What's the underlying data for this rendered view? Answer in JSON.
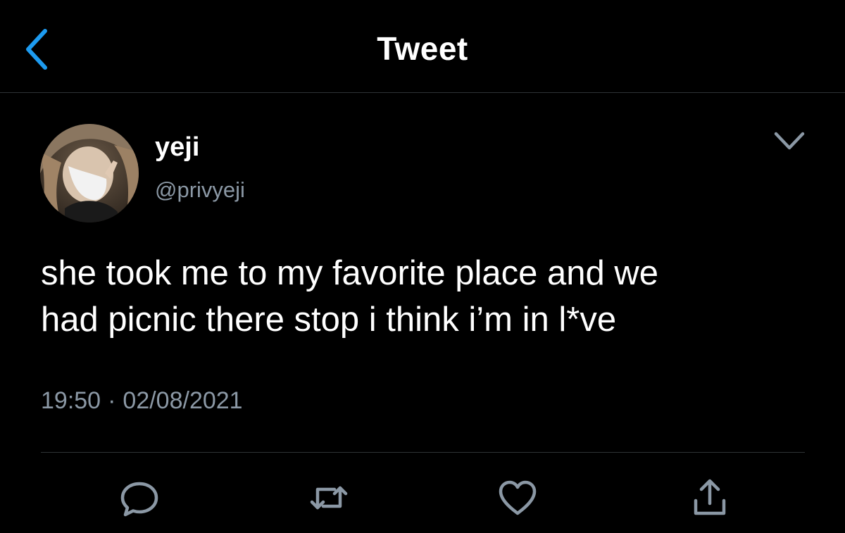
{
  "header": {
    "title": "Tweet",
    "back_icon": "chevron-left-icon"
  },
  "colors": {
    "accent": "#1d9bf0",
    "background": "#000000",
    "secondary_text": "#8b98a5",
    "divider": "#2f3336"
  },
  "author": {
    "display_name": "yeji",
    "handle": "@privyeji"
  },
  "tweet": {
    "lines": [
      "she took me to my favorite place and we",
      "had picnic there stop i think i’m in l*ve"
    ],
    "time": "19:50",
    "separator": "·",
    "date": "02/08/2021"
  },
  "actions": [
    {
      "name": "reply",
      "icon": "reply-icon"
    },
    {
      "name": "retweet",
      "icon": "retweet-icon"
    },
    {
      "name": "like",
      "icon": "heart-icon"
    },
    {
      "name": "share",
      "icon": "share-icon"
    }
  ]
}
